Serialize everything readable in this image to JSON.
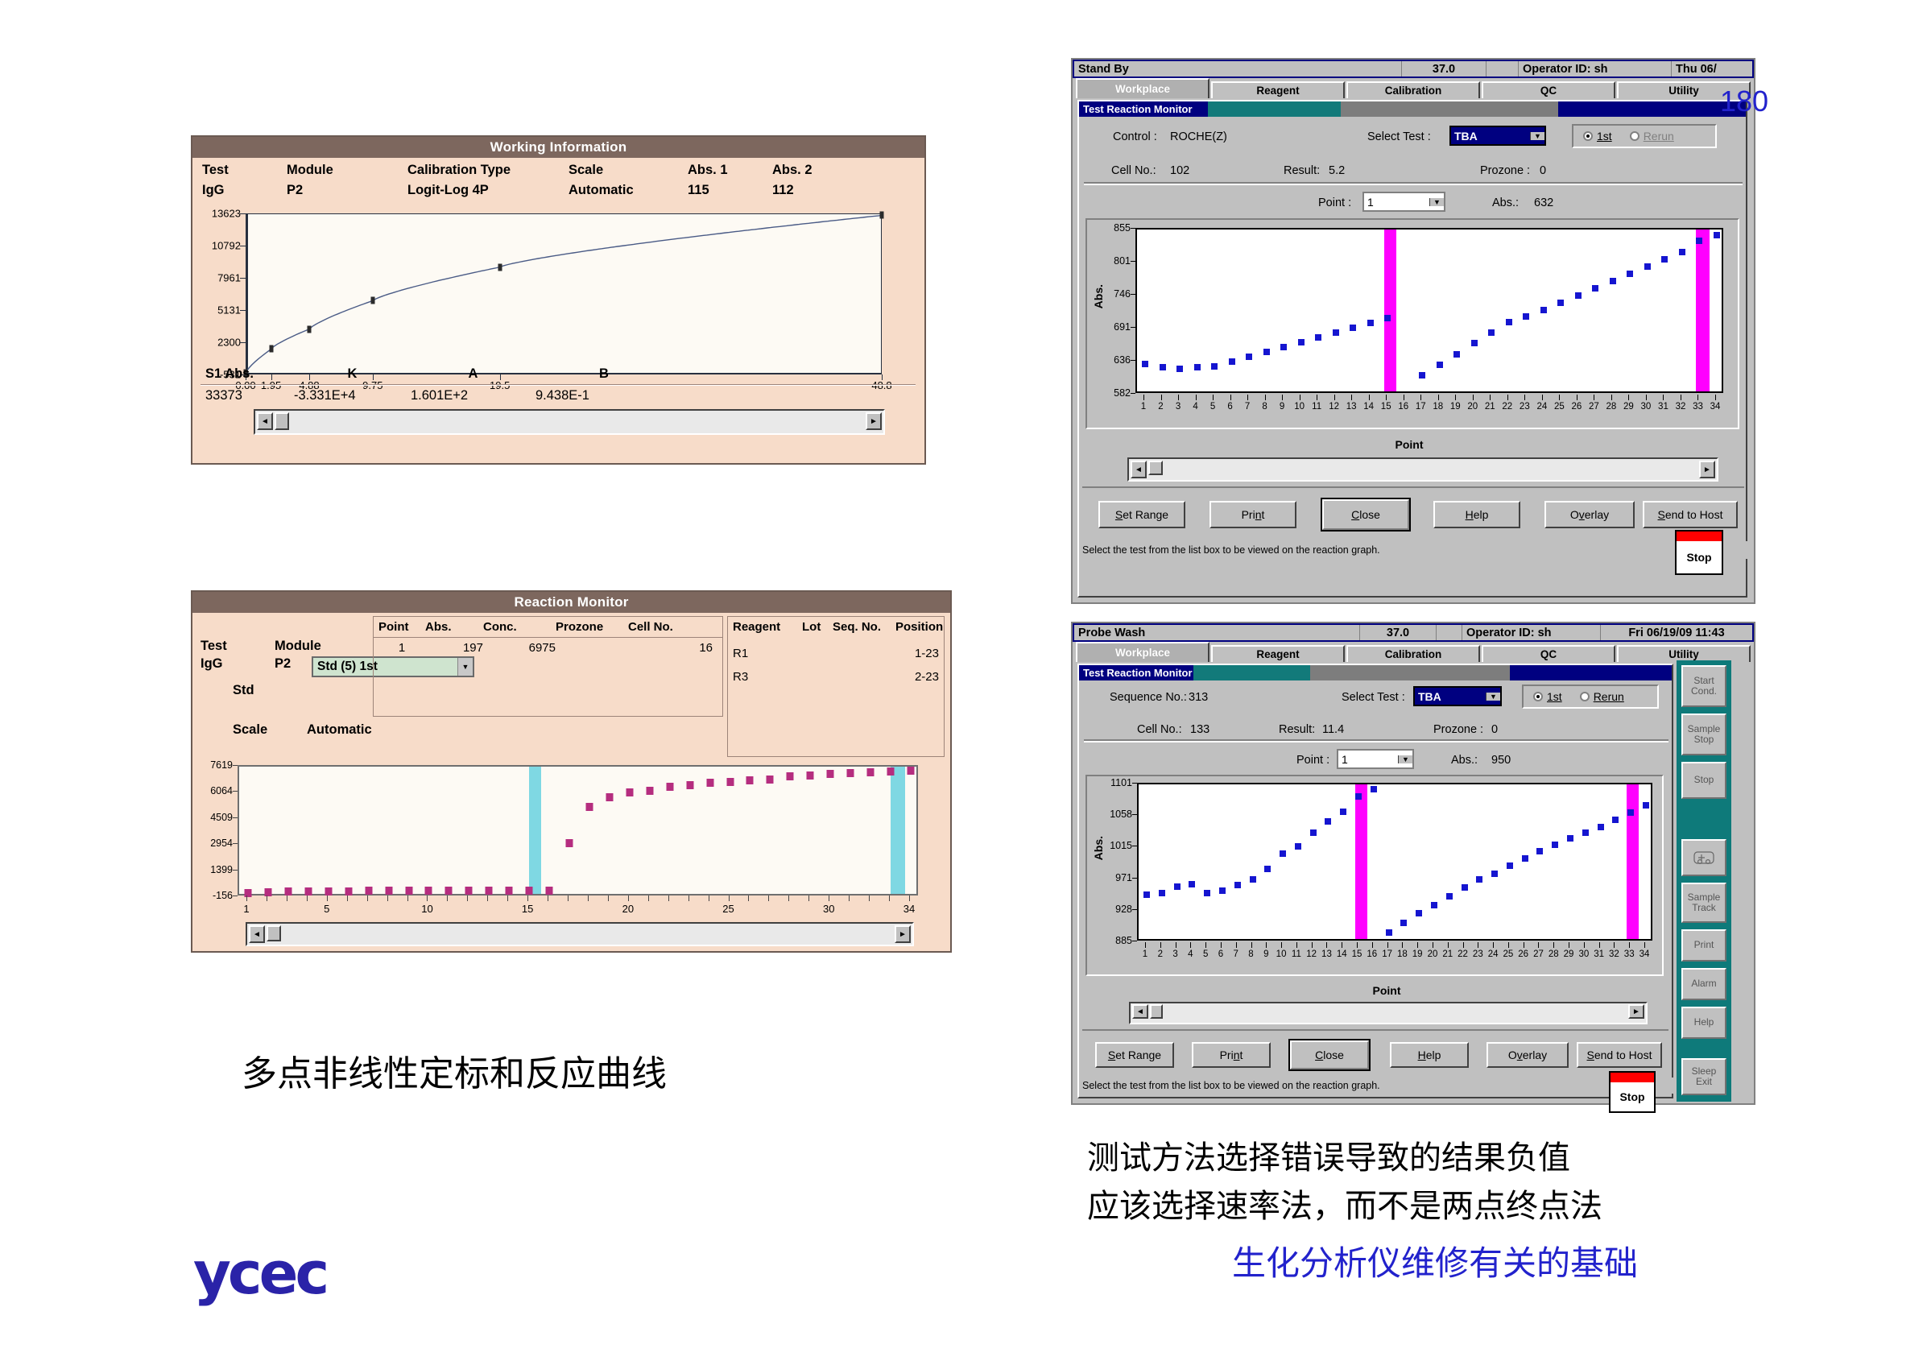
{
  "page": {
    "number": "180"
  },
  "logo": {
    "text": "ycec"
  },
  "working_information": {
    "title": "Working Information",
    "headers": [
      "Test",
      "Module",
      "Calibration Type",
      "Scale",
      "Abs. 1",
      "Abs. 2"
    ],
    "values": [
      "IgG",
      "P2",
      "Logit-Log 4P",
      "Automatic",
      "115",
      "112"
    ],
    "coef_headers": [
      "S1 Abs.",
      "K",
      "A",
      "B"
    ],
    "coef_values": [
      "33373",
      "-3.331E+4",
      "1.601E+2",
      "9.438E-1"
    ],
    "scroll_left": "◄",
    "scroll_right": "►"
  },
  "reaction_monitor": {
    "title": "Reaction Monitor",
    "left_labels": {
      "test": "Test",
      "test_value": "IgG",
      "module": "Module",
      "module_value": "P2",
      "std": "Std",
      "scale": "Scale",
      "scale_value": "Automatic"
    },
    "std_select": {
      "value": "Std (5) 1st",
      "arrow": "▼"
    },
    "table_headers": [
      "Point",
      "Abs.",
      "Conc.",
      "Prozone",
      "Cell No."
    ],
    "table_rows": [
      [
        "1",
        "197",
        "6975",
        "",
        "16"
      ]
    ],
    "reagent_headers": [
      "Reagent",
      "Lot",
      "Seq. No.",
      "Position"
    ],
    "reagent_rows": [
      [
        "R1",
        "",
        "",
        "1-23"
      ],
      [
        "R3",
        "",
        "",
        "2-23"
      ]
    ],
    "scroll_left": "◄",
    "scroll_right": "►"
  },
  "panel_top": {
    "status": {
      "mode": "Stand By",
      "temp": "37.0",
      "operator": "Operator ID: sh",
      "datetime": "Thu 06/"
    },
    "tabs": [
      "Workplace",
      "Reagent",
      "Calibration",
      "QC",
      "Utility"
    ],
    "selected_tab": "Workplace",
    "window_title": "Test Reaction Monitor",
    "fields": {
      "control_label": "Control :",
      "control_value": "ROCHE(Z)",
      "select_test_label": "Select Test :",
      "select_test_value": "TBA",
      "cell_no_label": "Cell No.:",
      "cell_no_value": "102",
      "result_label": "Result:",
      "result_value": "5.2",
      "prozone_label": "Prozone :",
      "prozone_value": "0",
      "point_label": "Point :",
      "point_value": "1",
      "abs_label": "Abs.:",
      "abs_value": "632"
    },
    "radios": [
      {
        "label": "1st",
        "checked": true,
        "dim": false
      },
      {
        "label": "Rerun",
        "checked": false,
        "dim": true
      }
    ],
    "buttons": [
      "Set Range",
      "Print",
      "Close",
      "Help",
      "Overlay",
      "Send to Host"
    ],
    "default_button": "Close",
    "stop_button": "Stop",
    "hint": "Select the test from the list box to be viewed on the reaction graph.",
    "arrow_down": "▼",
    "scroll_left": "◄",
    "scroll_right": "►"
  },
  "panel_bottom": {
    "status": {
      "mode": "Probe Wash",
      "temp": "37.0",
      "operator": "Operator ID: sh",
      "datetime": "Fri 06/19/09 11:43"
    },
    "tabs": [
      "Workplace",
      "Reagent",
      "Calibration",
      "QC",
      "Utility"
    ],
    "selected_tab": "Workplace",
    "window_title": "Test Reaction Monitor",
    "fields": {
      "sequence_label": "Sequence No.:",
      "sequence_value": "313",
      "select_test_label": "Select Test :",
      "select_test_value": "TBA",
      "cell_no_label": "Cell No.:",
      "cell_no_value": "133",
      "result_label": "Result:",
      "result_value": "11.4",
      "prozone_label": "Prozone :",
      "prozone_value": "0",
      "point_label": "Point :",
      "point_value": "1",
      "abs_label": "Abs.:",
      "abs_value": "950"
    },
    "radios": [
      {
        "label": "1st",
        "checked": true,
        "dim": false
      },
      {
        "label": "Rerun",
        "checked": false,
        "dim": false
      }
    ],
    "buttons": [
      "Set Range",
      "Print",
      "Close",
      "Help",
      "Overlay",
      "Send to Host"
    ],
    "default_button": "Close",
    "stop_button": "Stop",
    "hint": "Select the test from the list box to be viewed on the reaction graph.",
    "sidebar_buttons": [
      "Start Cond.",
      "Sample Stop",
      "Stop",
      "",
      "Sample Track",
      "Print",
      "Alarm",
      "Help",
      "Sleep Exit"
    ],
    "arrow_down": "▼",
    "scroll_left": "◄",
    "scroll_right": "►"
  },
  "captions": {
    "left": "多点非线性定标和反应曲线",
    "right1": "测试方法选择错误导致的结果负值",
    "right2": "应该选择速率法，而不是两点终点法",
    "right3": "生化分析仪维修有关的基础"
  },
  "colors": {
    "panel_bg": "#f7dcc9",
    "panel_title": "#7d675e",
    "calib_point": "#2b2b2b",
    "reaction_point": "#b52d7f",
    "reaction_band": "#7fd8e3",
    "monitor_point": "#1515d0",
    "monitor_band": "#ff00ff",
    "chrome": "#c0c0c0",
    "titlebar": "#000080",
    "teal": "#0e7a7a",
    "caption_blue": "#2222cc"
  },
  "chart_data": [
    {
      "type": "line",
      "title": "Working Information",
      "xlabel": "",
      "ylabel": "",
      "ylim": [
        -531,
        13623
      ],
      "ytick_labels": [
        "13623",
        "10792",
        "7961",
        "5131",
        "2300",
        "-531"
      ],
      "ytick_values": [
        13623,
        10792,
        7961,
        5131,
        2300,
        -531
      ],
      "xtick_labels": [
        "0.00",
        "1.95",
        "4.88",
        "9.75",
        "19.5",
        "48.8"
      ],
      "xtick_positions": [
        0.0,
        1.95,
        4.88,
        9.75,
        19.5,
        48.8
      ],
      "x": [
        0.0,
        1.95,
        4.88,
        9.75,
        19.5,
        48.8
      ],
      "y": [
        -380,
        1700,
        3450,
        5950,
        8900,
        13450
      ],
      "grid": false,
      "legend": "none",
      "markers": true,
      "marker_color": "#2b2b2b",
      "line_color": "#4a5b86"
    },
    {
      "type": "scatter",
      "title": "Reaction Monitor",
      "xlabel": "",
      "ylabel": "",
      "ylim": [
        -156,
        7619
      ],
      "ytick_labels": [
        "7619",
        "6064",
        "4509",
        "2954",
        "1399",
        "-156"
      ],
      "ytick_values": [
        7619,
        6064,
        4509,
        2954,
        1399,
        -156
      ],
      "xtick_labels": [
        "1",
        "5",
        "10",
        "15",
        "20",
        "25",
        "30",
        "34"
      ],
      "xtick_values": [
        1,
        5,
        10,
        15,
        20,
        25,
        30,
        34
      ],
      "x": [
        1,
        2,
        3,
        4,
        5,
        6,
        7,
        8,
        9,
        10,
        11,
        12,
        13,
        14,
        15,
        16,
        17,
        18,
        19,
        20,
        21,
        22,
        23,
        24,
        25,
        26,
        27,
        28,
        29,
        30,
        31,
        32,
        33,
        34
      ],
      "y": [
        60,
        150,
        160,
        170,
        200,
        200,
        210,
        215,
        215,
        220,
        215,
        210,
        225,
        230,
        215,
        215,
        3060,
        5200,
        5790,
        6060,
        6200,
        6400,
        6530,
        6640,
        6720,
        6800,
        6870,
        7060,
        7110,
        7190,
        7230,
        7290,
        7350,
        7380
      ],
      "bands": [
        {
          "from": 15,
          "to": 15.6,
          "color": "#7fd8e3"
        },
        {
          "from": 33,
          "to": 33.7,
          "color": "#7fd8e3"
        }
      ],
      "grid": false,
      "legend": "none",
      "marker_color": "#b52d7f"
    },
    {
      "type": "scatter",
      "title": "Test Reaction Monitor (Stand By)",
      "xlabel": "Point",
      "ylabel": "Abs.",
      "ylim": [
        582,
        855
      ],
      "ytick_labels": [
        "855",
        "801",
        "746",
        "691",
        "636",
        "582"
      ],
      "ytick_values": [
        855,
        801,
        746,
        691,
        636,
        582
      ],
      "xtick_labels": [
        "1",
        "2",
        "3",
        "4",
        "5",
        "6",
        "7",
        "8",
        "9",
        "10",
        "11",
        "12",
        "13",
        "14",
        "15",
        "16",
        "17",
        "18",
        "19",
        "20",
        "21",
        "22",
        "23",
        "24",
        "25",
        "26",
        "27",
        "28",
        "29",
        "30",
        "31",
        "32",
        "33",
        "34"
      ],
      "x": [
        1,
        2,
        3,
        4,
        5,
        6,
        7,
        8,
        9,
        10,
        11,
        12,
        13,
        14,
        15,
        16,
        17,
        18,
        19,
        20,
        21,
        22,
        23,
        24,
        25,
        26,
        27,
        28,
        29,
        30,
        31,
        32,
        33,
        34
      ],
      "y": [
        632,
        627,
        624,
        627,
        629,
        636,
        644,
        652,
        660,
        668,
        676,
        684,
        692,
        700,
        708,
        null,
        614,
        631,
        649,
        667,
        684,
        702,
        711,
        722,
        734,
        746,
        758,
        770,
        782,
        794,
        806,
        818,
        836,
        846
      ],
      "bands": [
        {
          "from": 14.8,
          "to": 15.5,
          "color": "#ff00ff"
        },
        {
          "from": 32.8,
          "to": 33.6,
          "color": "#ff00ff"
        }
      ],
      "grid": false,
      "legend": "none",
      "marker_color": "#1515d0"
    },
    {
      "type": "scatter",
      "title": "Test Reaction Monitor (Probe Wash)",
      "xlabel": "Point",
      "ylabel": "Abs.",
      "ylim": [
        885,
        1101
      ],
      "ytick_labels": [
        "1101",
        "1058",
        "1015",
        "971",
        "928",
        "885"
      ],
      "ytick_values": [
        1101,
        1058,
        1015,
        971,
        928,
        885
      ],
      "xtick_labels": [
        "1",
        "2",
        "3",
        "4",
        "5",
        "6",
        "7",
        "8",
        "9",
        "10",
        "11",
        "12",
        "13",
        "14",
        "15",
        "16",
        "17",
        "18",
        "19",
        "20",
        "21",
        "22",
        "23",
        "24",
        "25",
        "26",
        "27",
        "28",
        "29",
        "30",
        "31",
        "32",
        "33",
        "34"
      ],
      "x": [
        1,
        2,
        3,
        4,
        5,
        6,
        7,
        8,
        9,
        10,
        11,
        12,
        13,
        14,
        15,
        16,
        17,
        18,
        19,
        20,
        21,
        22,
        23,
        24,
        25,
        26,
        27,
        28,
        29,
        30,
        31,
        32,
        33,
        34
      ],
      "y": [
        950,
        952,
        961,
        964,
        952,
        956,
        963,
        971,
        985,
        1006,
        1016,
        1035,
        1050,
        1063,
        1085,
        1094,
        898,
        911,
        925,
        936,
        948,
        960,
        971,
        979,
        990,
        1000,
        1009,
        1018,
        1027,
        1035,
        1043,
        1052,
        1062,
        1072
      ],
      "bands": [
        {
          "from": 14.8,
          "to": 15.6,
          "color": "#ff00ff"
        },
        {
          "from": 32.7,
          "to": 33.5,
          "color": "#ff00ff"
        }
      ],
      "grid": false,
      "legend": "none",
      "marker_color": "#1515d0"
    }
  ]
}
